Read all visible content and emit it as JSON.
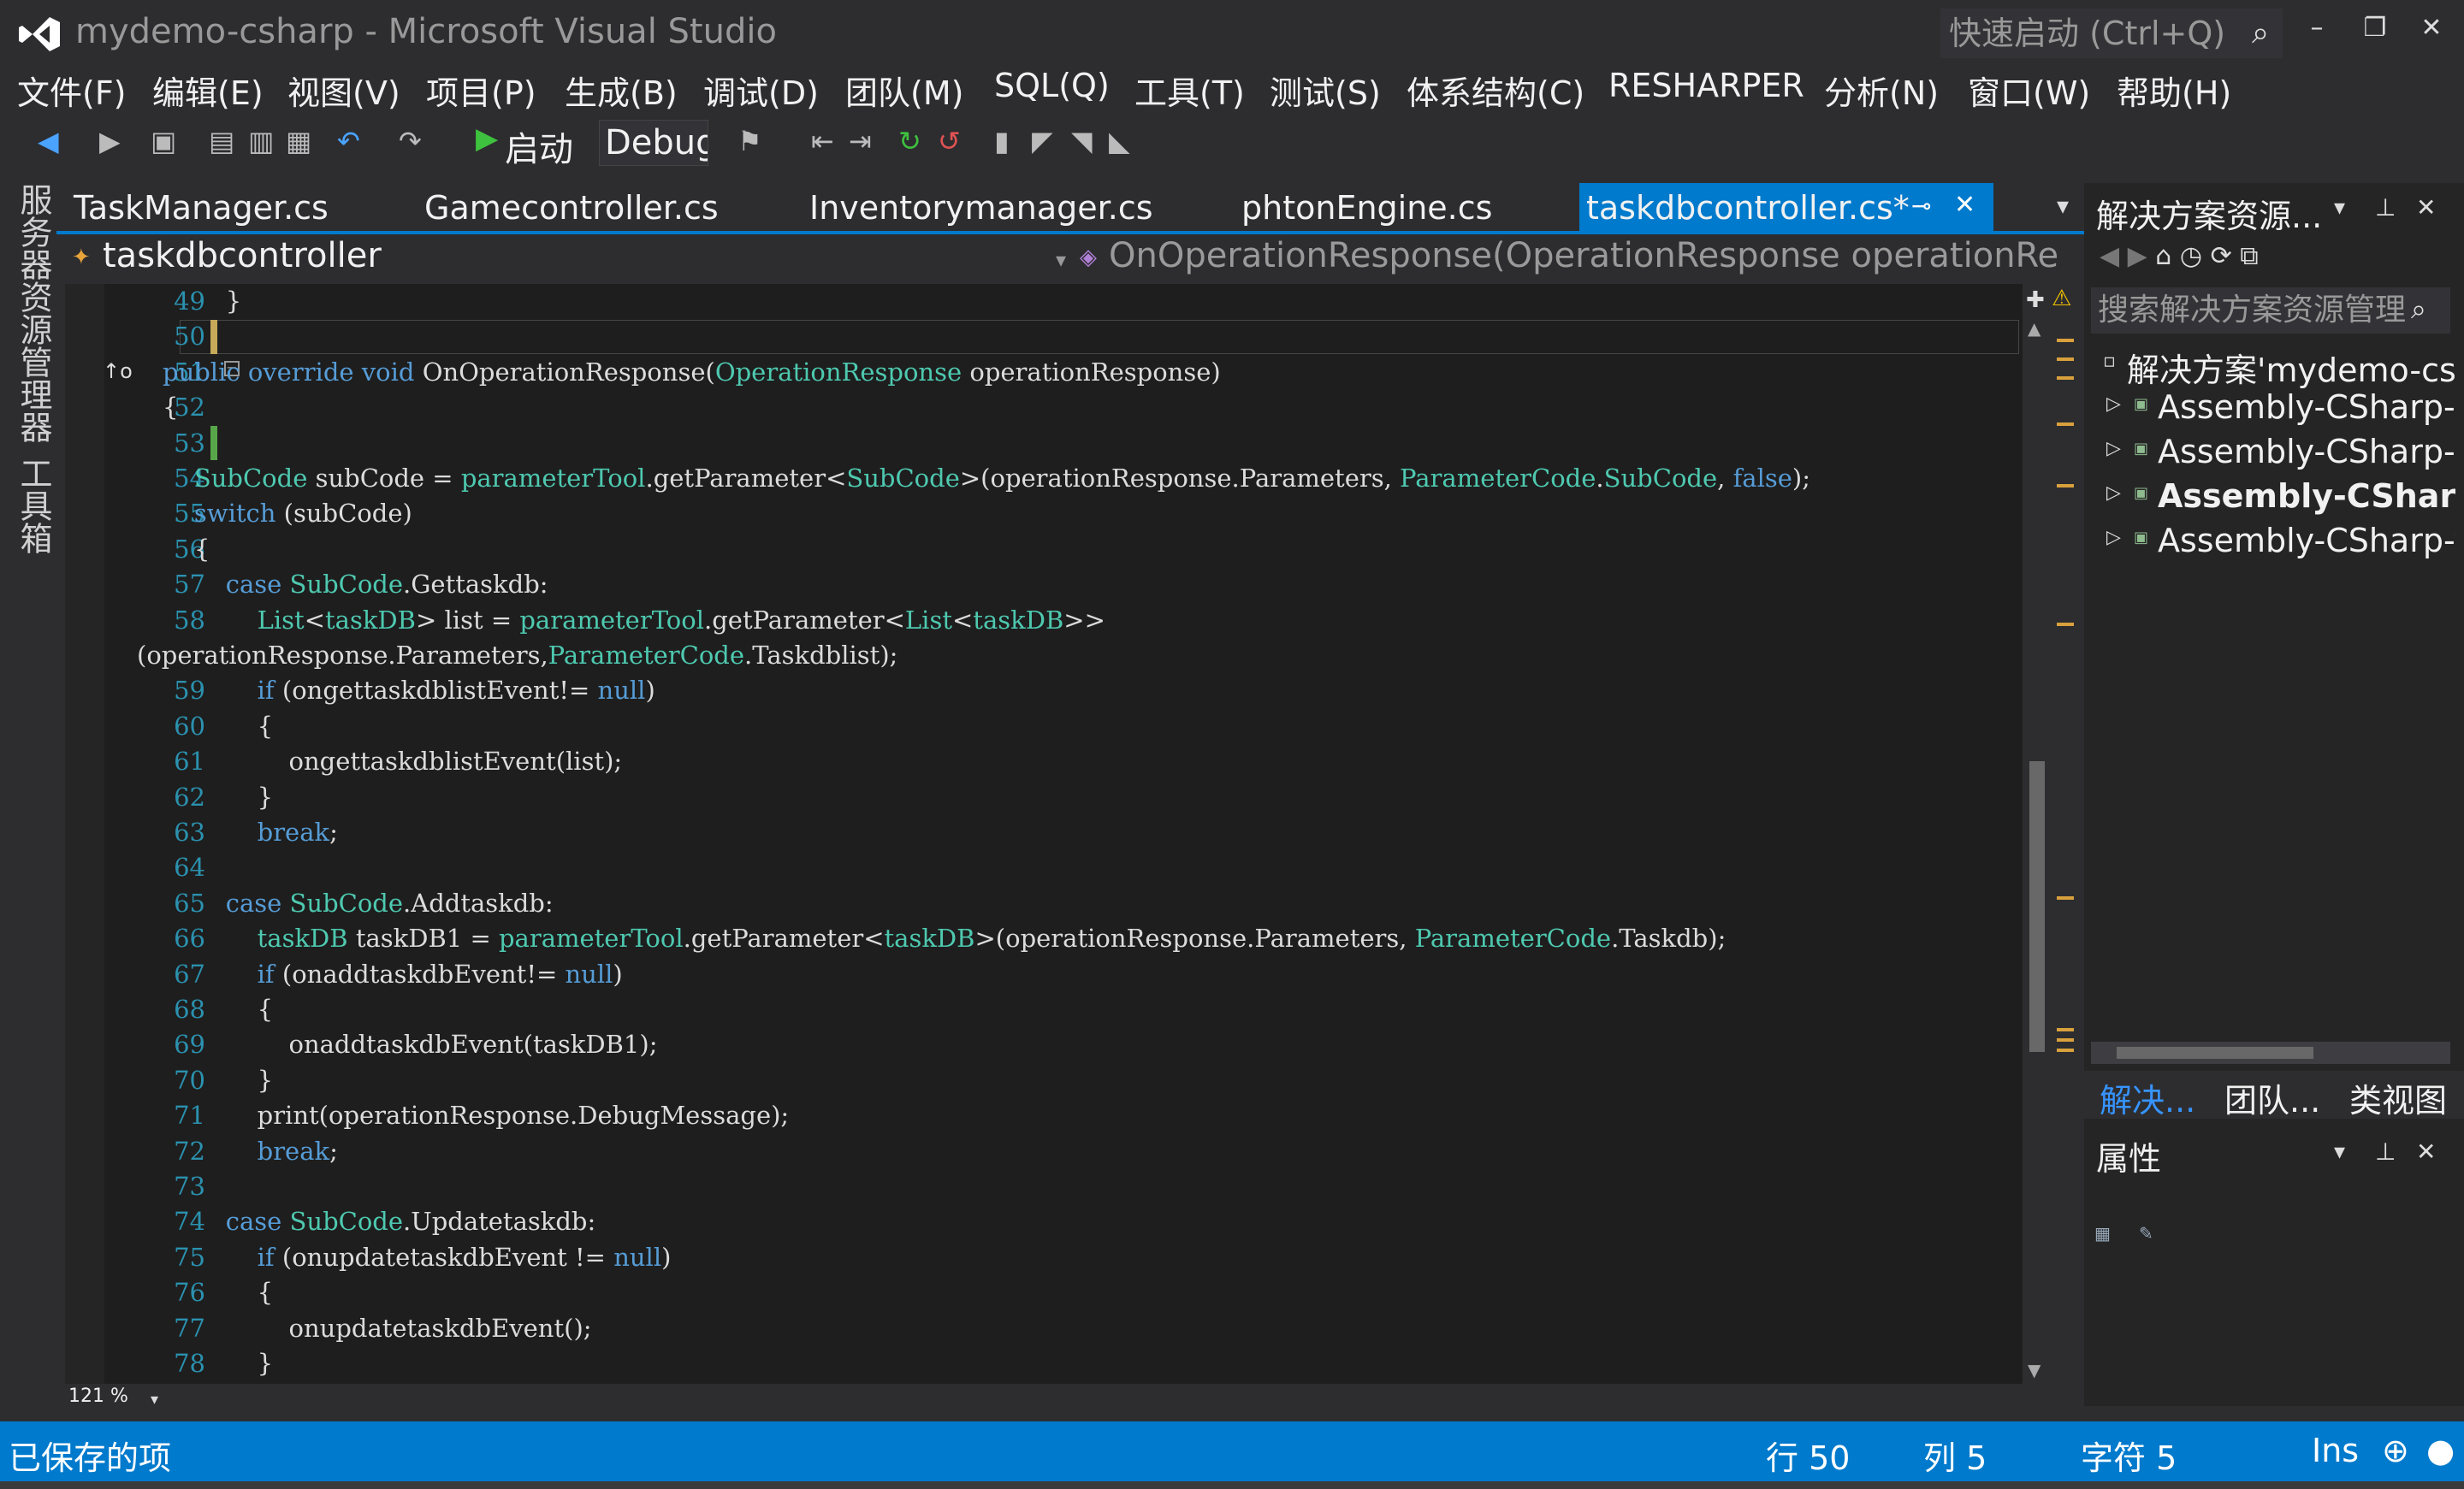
{
  "window": {
    "title": "mydemo-csharp - Microsoft Visual Studio",
    "quick_launch_placeholder": "快速启动 (Ctrl+Q)"
  },
  "menu": [
    "文件(F)",
    "编辑(E)",
    "视图(V)",
    "项目(P)",
    "生成(B)",
    "调试(D)",
    "团队(M)",
    "SQL(Q)",
    "工具(T)",
    "测试(S)",
    "体系结构(C)",
    "RESHARPER",
    "分析(N)",
    "窗口(W)",
    "帮助(H)"
  ],
  "toolbar": {
    "start_label": "启动",
    "config_value": "Debug"
  },
  "side_tabs": [
    "服务器资源管理器",
    "工具箱"
  ],
  "doc_tabs": [
    "TaskManager.cs",
    "Gamecontroller.cs",
    "Inventorymanager.cs",
    "phtonEngine.cs",
    "taskdbcontroller.cs*"
  ],
  "navbar": {
    "class_name": "taskdbcontroller",
    "member_name": "OnOperationResponse(OperationResponse operationRespons"
  },
  "editor": {
    "zoom": "121 %",
    "lines": [
      {
        "n": "49",
        "t": "        }"
      },
      {
        "n": "50",
        "t": ""
      },
      {
        "n": "51",
        "t": "public override void OnOperationResponse(OperationResponse operationResponse)"
      },
      {
        "n": "52",
        "t": "{"
      },
      {
        "n": "53",
        "t": ""
      },
      {
        "n": "54",
        "t": "    SubCode subCode = parameterTool.getParameter<SubCode>(operationResponse.Parameters, ParameterCode.SubCode, false);"
      },
      {
        "n": "55",
        "t": "    switch (subCode)"
      },
      {
        "n": "56",
        "t": "    {"
      },
      {
        "n": "57",
        "t": "        case SubCode.Gettaskdb:"
      },
      {
        "n": "58",
        "t": "            List<taskDB> list = parameterTool.getParameter<List<taskDB>>"
      },
      {
        "n": "",
        "t": "(operationResponse.Parameters,ParameterCode.Taskdblist);"
      },
      {
        "n": "59",
        "t": "            if (ongettaskdblistEvent!= null)"
      },
      {
        "n": "60",
        "t": "            {"
      },
      {
        "n": "61",
        "t": "                ongettaskdblistEvent(list);"
      },
      {
        "n": "62",
        "t": "            }"
      },
      {
        "n": "63",
        "t": "            break;"
      },
      {
        "n": "64",
        "t": ""
      },
      {
        "n": "65",
        "t": "        case SubCode.Addtaskdb:"
      },
      {
        "n": "66",
        "t": "            taskDB taskDB1 = parameterTool.getParameter<taskDB>(operationResponse.Parameters, ParameterCode.Taskdb);"
      },
      {
        "n": "67",
        "t": "            if (onaddtaskdbEvent!= null)"
      },
      {
        "n": "68",
        "t": "            {"
      },
      {
        "n": "69",
        "t": "                onaddtaskdbEvent(taskDB1);"
      },
      {
        "n": "70",
        "t": "            }"
      },
      {
        "n": "71",
        "t": "            print(operationResponse.DebugMessage);"
      },
      {
        "n": "72",
        "t": "            break;"
      },
      {
        "n": "73",
        "t": ""
      },
      {
        "n": "74",
        "t": "        case SubCode.Updatetaskdb:"
      },
      {
        "n": "75",
        "t": "            if (onupdatetaskdbEvent != null)"
      },
      {
        "n": "76",
        "t": "            {"
      },
      {
        "n": "77",
        "t": "                onupdatetaskdbEvent();"
      },
      {
        "n": "78",
        "t": "            }"
      }
    ]
  },
  "solution_explorer": {
    "title": "解决方案资源...",
    "search_placeholder": "搜索解决方案资源管理",
    "root": "解决方案'mydemo-csh",
    "items": [
      "Assembly-CSharp-E",
      "Assembly-CSharp-E",
      "Assembly-CSharp-",
      "Assembly-CSharp-v"
    ],
    "tabs": [
      "解决...",
      "团队...",
      "类视图"
    ],
    "properties_title": "属性"
  },
  "status": {
    "left": "已保存的项",
    "row": "行 50",
    "col": "列 5",
    "char": "字符 5",
    "mode": "Ins"
  },
  "colors": {
    "accent": "#007acc",
    "keyword": "#569cd6",
    "type": "#4ec9b0",
    "line_number": "#2b91af",
    "editor_bg": "#1e1e1e"
  }
}
